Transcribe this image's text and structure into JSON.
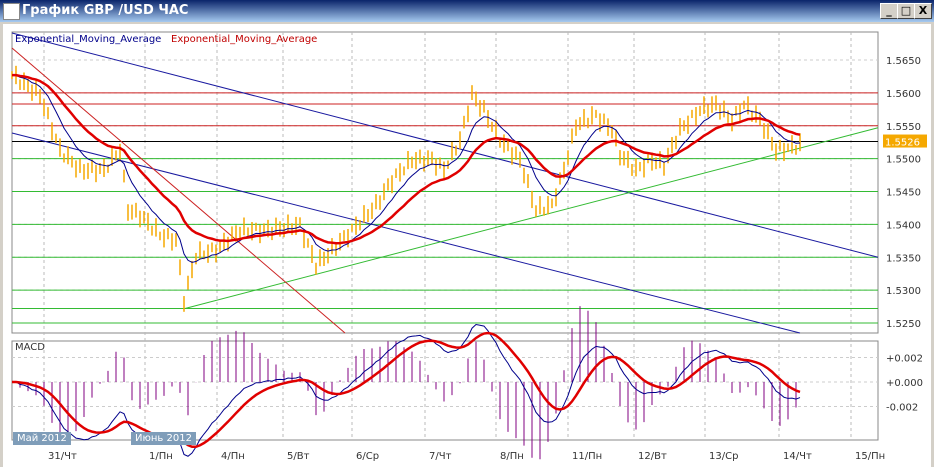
{
  "window": {
    "title": "График GBP /USD  ЧАС",
    "minimize": "_",
    "maximize": "□",
    "close": "X"
  },
  "legend": {
    "ema_fast": "Exponential_Moving_Average",
    "ema_slow": "Exponential_Moving_Average"
  },
  "macd_label": "MACD",
  "colors": {
    "candles": "#f5a800",
    "ema_fast": "#00008b",
    "ema_slow": "#e00000",
    "support": "#33bb33",
    "resistance": "#cc2222",
    "trend_down": "#1a1aa0",
    "price_tag": "#f5a800"
  },
  "chart_data": {
    "type": "line",
    "title": "График GBP /USD ЧАС",
    "price_ticks": [
      "1.5650",
      "1.5600",
      "1.5550",
      "1.5500",
      "1.5450",
      "1.5400",
      "1.5350",
      "1.5300",
      "1.5250"
    ],
    "ylim": [
      1.5215,
      1.5692
    ],
    "current_price": "1.5526",
    "macd_ticks": [
      "+0.002",
      "+0.000",
      "-0.002"
    ],
    "months": [
      "Май 2012",
      "Июнь 2012"
    ],
    "x_labels": [
      {
        "d": "31",
        "w": "Чт"
      },
      {
        "d": "1",
        "w": "Пн"
      },
      {
        "d": "4",
        "w": "Пн"
      },
      {
        "d": "5",
        "w": "Вт"
      },
      {
        "d": "6",
        "w": "Ср"
      },
      {
        "d": "7",
        "w": "Чт"
      },
      {
        "d": "8",
        "w": "Пн"
      },
      {
        "d": "11",
        "w": "Пн"
      },
      {
        "d": "12",
        "w": "Вт"
      },
      {
        "d": "13",
        "w": "Ср"
      },
      {
        "d": "14",
        "w": "Чт"
      },
      {
        "d": "15",
        "w": "Пн"
      }
    ],
    "resistance_levels": [
      1.56,
      1.5583,
      1.555
    ],
    "current_level": 1.5526,
    "support_levels": [
      1.55,
      1.545,
      1.54,
      1.535,
      1.53,
      1.5272,
      1.525
    ],
    "price_anchors": [
      [
        0,
        1.5627
      ],
      [
        7,
        1.5597
      ],
      [
        12,
        1.5513
      ],
      [
        17,
        1.5483
      ],
      [
        23,
        1.5483
      ],
      [
        27,
        1.5513
      ],
      [
        29,
        1.5422
      ],
      [
        32,
        1.5414
      ],
      [
        37,
        1.5384
      ],
      [
        41,
        1.5376
      ],
      [
        43,
        1.5285
      ],
      [
        46,
        1.5353
      ],
      [
        51,
        1.5361
      ],
      [
        57,
        1.5391
      ],
      [
        64,
        1.5391
      ],
      [
        72,
        1.5399
      ],
      [
        76,
        1.5338
      ],
      [
        80,
        1.5361
      ],
      [
        85,
        1.5391
      ],
      [
        91,
        1.5429
      ],
      [
        95,
        1.5467
      ],
      [
        100,
        1.5498
      ],
      [
        105,
        1.5498
      ],
      [
        108,
        1.5483
      ],
      [
        112,
        1.5528
      ],
      [
        115,
        1.5597
      ],
      [
        118,
        1.5574
      ],
      [
        122,
        1.5528
      ],
      [
        127,
        1.5498
      ],
      [
        131,
        1.5422
      ],
      [
        135,
        1.5429
      ],
      [
        138,
        1.5483
      ],
      [
        141,
        1.5551
      ],
      [
        146,
        1.5566
      ],
      [
        150,
        1.5544
      ],
      [
        152,
        1.5506
      ],
      [
        156,
        1.5483
      ],
      [
        160,
        1.5498
      ],
      [
        163,
        1.549
      ],
      [
        167,
        1.5544
      ],
      [
        172,
        1.5574
      ],
      [
        176,
        1.5582
      ],
      [
        180,
        1.5559
      ],
      [
        183,
        1.5582
      ],
      [
        187,
        1.5559
      ],
      [
        191,
        1.5513
      ],
      [
        194,
        1.5516
      ],
      [
        197,
        1.5521
      ]
    ]
  }
}
